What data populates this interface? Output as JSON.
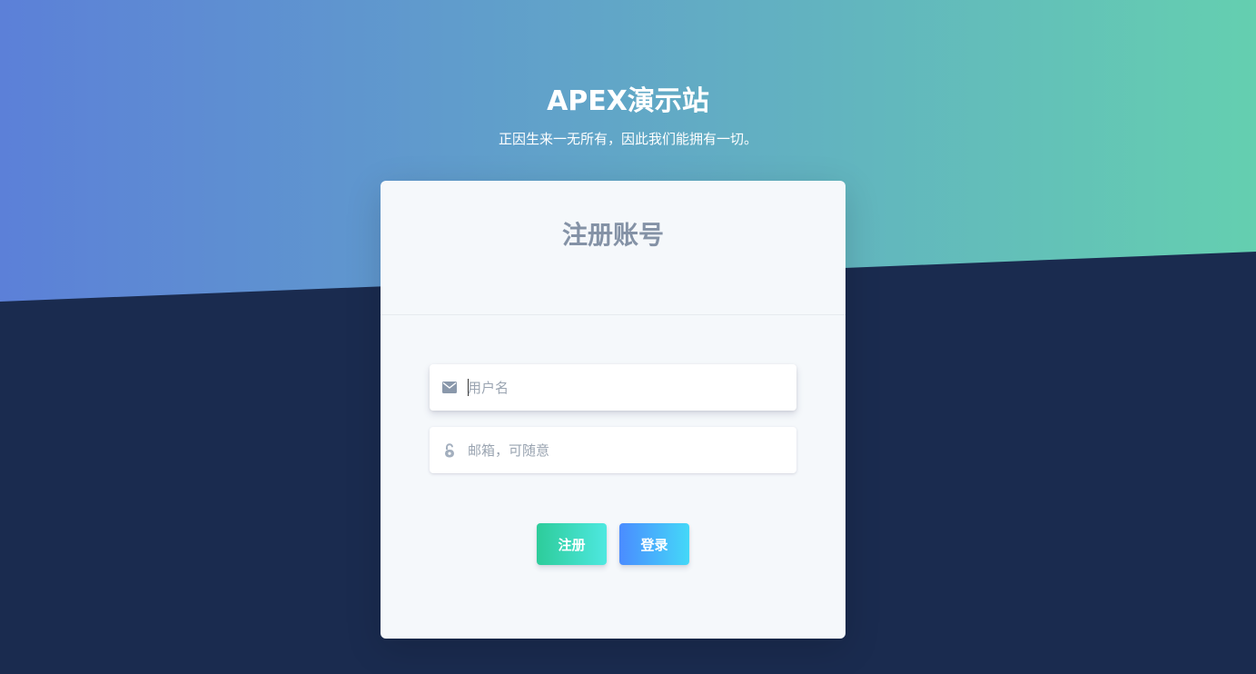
{
  "hero": {
    "title": "APEX演示站",
    "subtitle": "正因生来一无所有，因此我们能拥有一切。"
  },
  "card": {
    "title": "注册账号",
    "username": {
      "placeholder": "用户名",
      "value": "",
      "icon": "envelope-icon"
    },
    "email": {
      "placeholder": "邮箱，可随意",
      "value": "",
      "icon": "unlock-icon"
    },
    "register_label": "注册",
    "login_label": "登录"
  },
  "colors": {
    "gradient_start": "#5c80d8",
    "gradient_end": "#64cfb0",
    "background": "#1a2b4f",
    "card": "#f5f8fb",
    "title_gray": "#8492a6"
  }
}
